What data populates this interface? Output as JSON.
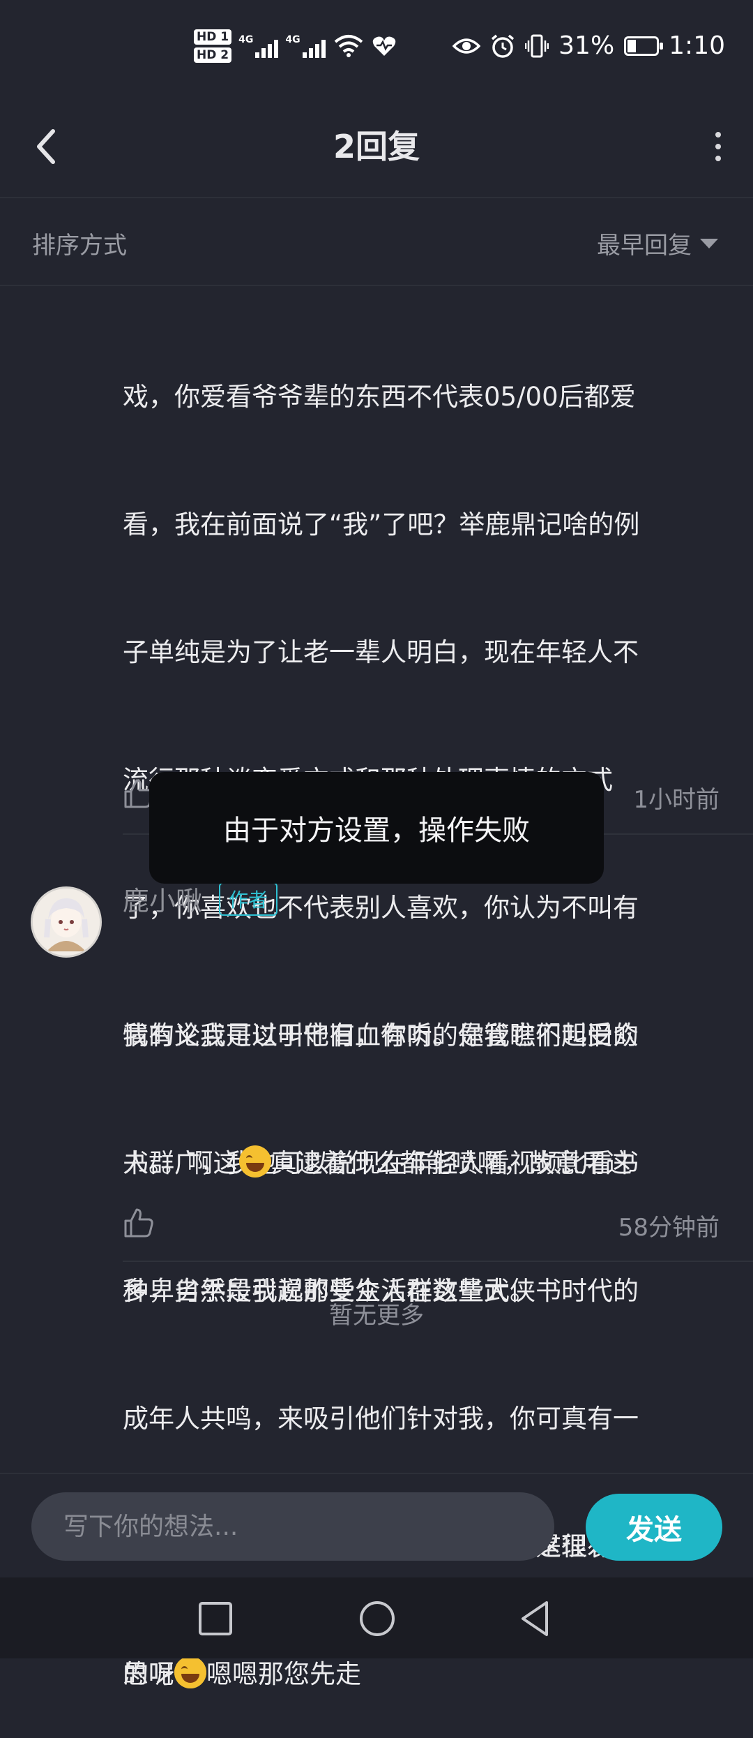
{
  "status_bar": {
    "hd1": "HD 1",
    "hd2": "HD 2",
    "net1": "4G",
    "net2": "4G",
    "battery_pct": "31%",
    "battery_level": 0.31,
    "time": "1:10"
  },
  "header": {
    "title": "2回复"
  },
  "sort": {
    "label": "排序方式",
    "value": "最早回复"
  },
  "comments": [
    {
      "text_lines": [
        "戏，你爱看爷爷辈的东西不代表05/00后都爱",
        "看，我在前面说了“我”了吧？举鹿鼎记啥的例",
        "子单纯是为了让老一辈人明白，现在年轻人不",
        "流行那种谈恋爱方式和那种处理事情的方式",
        "了，你喜欢也不代表别人喜欢，你认为不叫有",
        "情有义我可以叫他有血有肉。你管它们叫受众",
        "人群广，我也可以说现在年轻人看视频比看书",
        "多，自然是我说的受众人群数量大。"
      ],
      "text_tail_1": "还有啊，你评论完给自己点赞，真的是很有意",
      "text_tail_2": "思呢",
      "time": "1小时前"
    },
    {
      "author": "鹿小啾",
      "author_tag": "作者",
      "text_1": "我的论点是过于守旧，你听的是我瞧不起旧的",
      "text_2a": "书。。啊这",
      "text_2b": "真逮着什么都能喷啊，故意用这",
      "text_3": "种卑劣手段引起那些生活在这些武侠书时代的",
      "text_4": "成年人共鸣，来吸引他们针对我，你可真有一",
      "text_5": "手。原来这年头提个建议还能遇到在这理发店",
      "text_6a": "的呀",
      "text_6b": "嗯嗯那您先走",
      "time": "58分钟前"
    }
  ],
  "no_more": "暂无更多",
  "toast": "由于对方设置，操作失败",
  "input": {
    "placeholder": "写下你的想法..."
  },
  "send_label": "发送",
  "icons": {
    "back": "back-arrow-icon",
    "more": "more-vertical-icon",
    "sort": "caret-down-icon",
    "like": "thumbs-up-icon",
    "emoji": "laughing-tears-emoji",
    "nav_recent": "square-icon",
    "nav_home": "circle-icon",
    "nav_back": "triangle-back-icon"
  }
}
